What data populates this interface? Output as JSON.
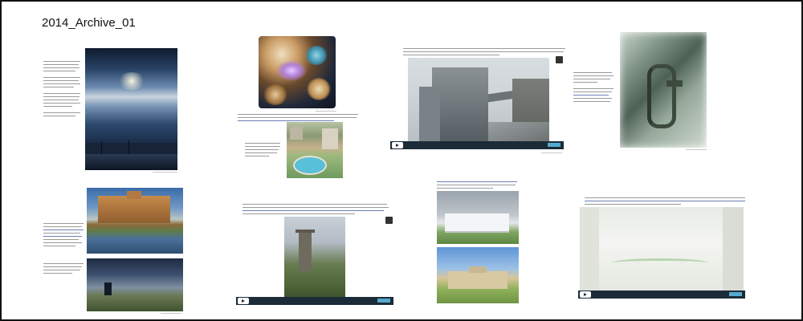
{
  "page": {
    "title": "2014_Archive_01"
  },
  "colors": {
    "frame_border": "#111111",
    "video_bar": "#1b2b38",
    "link_text": "#6c7fb8"
  },
  "icons": {
    "play": "play-icon",
    "share": "share-icon"
  }
}
